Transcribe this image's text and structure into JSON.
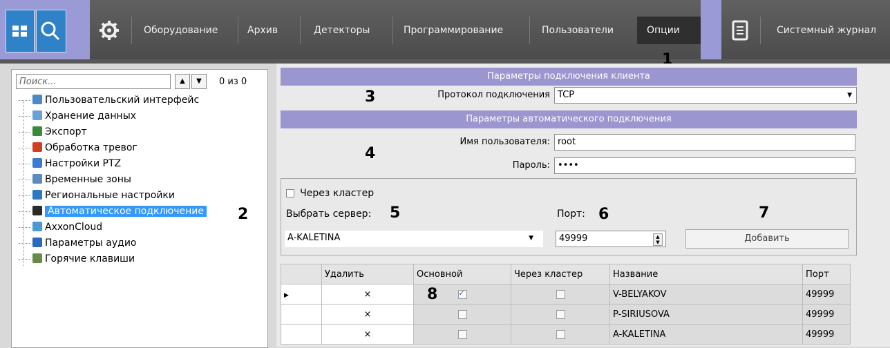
{
  "topbar": {
    "nav": [
      "Оборудование",
      "Архив",
      "Детекторы",
      "Программирование",
      "Пользователи",
      "Опции",
      "Системный журнал"
    ],
    "active": "Опции",
    "icons": [
      "windows-grid-icon",
      "search-icon",
      "gear-icon",
      "journal-icon"
    ]
  },
  "callouts": [
    "1",
    "2",
    "3",
    "4",
    "5",
    "6",
    "7",
    "8"
  ],
  "left": {
    "search_placeholder": "Поиск...",
    "count": "0 из 0",
    "tree": [
      {
        "label": "Пользовательский интерфейс",
        "icon": "monitor-icon",
        "color": "#4a88c8"
      },
      {
        "label": "Хранение данных",
        "icon": "storage-icon",
        "color": "#6aa0d8"
      },
      {
        "label": "Экспорт",
        "icon": "export-icon",
        "color": "#3b8a3b"
      },
      {
        "label": "Обработка тревог",
        "icon": "alarm-icon",
        "color": "#d04020"
      },
      {
        "label": "Настройки PTZ",
        "icon": "ptz-icon",
        "color": "#3a7ad0"
      },
      {
        "label": "Временные зоны",
        "icon": "timezone-icon",
        "color": "#5a8ac0"
      },
      {
        "label": "Региональные настройки",
        "icon": "globe-icon",
        "color": "#2a7ac0"
      },
      {
        "label": "Автоматическое подключение",
        "icon": "auto-connect-icon",
        "color": "#2a2a2a",
        "selected": true
      },
      {
        "label": "AxxonCloud",
        "icon": "cloud-icon",
        "color": "#4a9ad8"
      },
      {
        "label": "Параметры аудио",
        "icon": "audio-icon",
        "color": "#2a6ac0"
      },
      {
        "label": "Горячие клавиши",
        "icon": "hotkeys-icon",
        "color": "#6a8a4a"
      }
    ]
  },
  "right": {
    "client_header": "Параметры подключения клиента",
    "protocol_label": "Протокол подключения",
    "protocol_value": "TCP",
    "auto_header": "Параметры автоматического подключения",
    "user_label": "Имя пользователя:",
    "user_value": "root",
    "password_label": "Пароль:",
    "password_value": "••••",
    "via_cluster_label": "Через кластер",
    "select_server_label": "Выбрать сервер:",
    "server_value": "A-KALETINA",
    "port_label": "Порт:",
    "port_value": "49999",
    "add_button": "Добавить",
    "columns": [
      "",
      "Удалить",
      "Основной",
      "Через кластер",
      "Название",
      "Порт"
    ],
    "rows": [
      {
        "current": true,
        "delete": "×",
        "main": true,
        "cluster": false,
        "name": "V-BELYAKOV",
        "port": "49999"
      },
      {
        "current": false,
        "delete": "×",
        "main": false,
        "cluster": false,
        "name": "P-SIRIUSOVA",
        "port": "49999"
      },
      {
        "current": false,
        "delete": "×",
        "main": false,
        "cluster": false,
        "name": "A-KALETINA",
        "port": "49999"
      }
    ]
  }
}
